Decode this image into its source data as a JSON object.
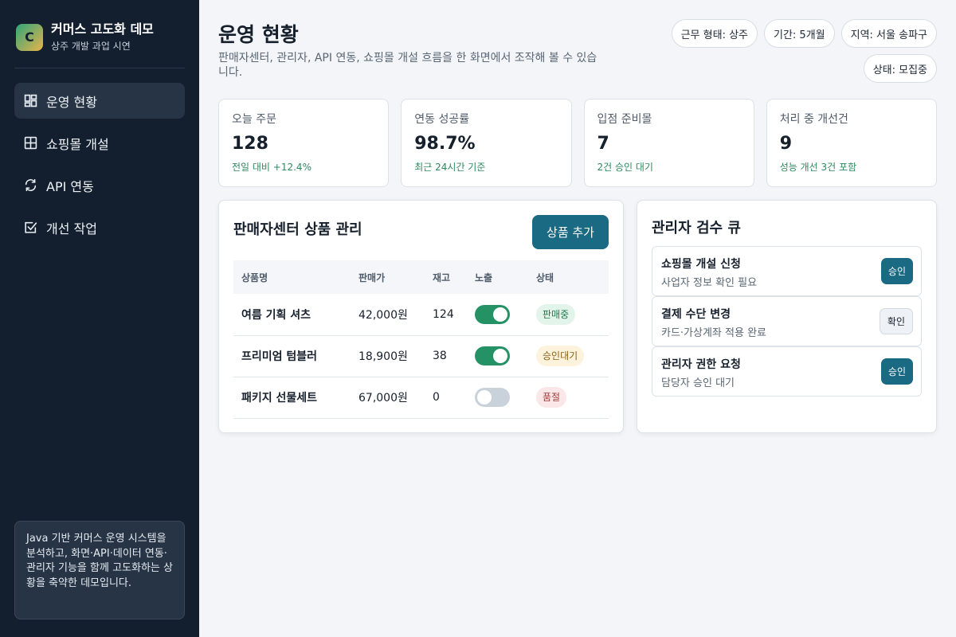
{
  "brand": {
    "logo_letter": "C",
    "title": "커머스 고도화 데모",
    "subtitle": "상주 개발 과업 시연"
  },
  "nav": [
    {
      "label": "운영 현황",
      "icon": "dashboard-icon",
      "active": true
    },
    {
      "label": "쇼핑몰 개설",
      "icon": "grid-icon",
      "active": false
    },
    {
      "label": "API 연동",
      "icon": "sync-icon",
      "active": false
    },
    {
      "label": "개선 작업",
      "icon": "checkbox-icon",
      "active": false
    }
  ],
  "sidebar_note": "Java 기반 커머스 운영 시스템을 분석하고, 화면·API·데이터 연동·관리자 기능을 함께 고도화하는 상황을 축약한 데모입니다.",
  "page": {
    "title": "운영 현황",
    "description": "판매자센터, 관리자, API 연동, 쇼핑몰 개설 흐름을 한 화면에서 조작해 볼 수 있습니다."
  },
  "chips": [
    "근무 형태: 상주",
    "기간: 5개월",
    "지역: 서울 송파구",
    "상태: 모집중"
  ],
  "stats": [
    {
      "label": "오늘 주문",
      "value": "128",
      "note": "전일 대비 +12.4%"
    },
    {
      "label": "연동 성공률",
      "value": "98.7%",
      "note": "최근 24시간 기준"
    },
    {
      "label": "입점 준비몰",
      "value": "7",
      "note": "2건 승인 대기"
    },
    {
      "label": "처리 중 개선건",
      "value": "9",
      "note": "성능 개선 3건 포함"
    }
  ],
  "products": {
    "title": "판매자센터 상품 관리",
    "add_label": "상품 추가",
    "columns": [
      "상품명",
      "판매가",
      "재고",
      "노출",
      "상태"
    ],
    "rows": [
      {
        "name": "여름 기획 셔츠",
        "price": "42,000원",
        "stock": "124",
        "visible": true,
        "status": "판매중",
        "status_bg": "#e3f5ea",
        "status_fg": "#1f7a4d"
      },
      {
        "name": "프리미엄 텀블러",
        "price": "18,900원",
        "stock": "38",
        "visible": true,
        "status": "승인대기",
        "status_bg": "#fdf3dc",
        "status_fg": "#8a6116"
      },
      {
        "name": "패키지 선물세트",
        "price": "67,000원",
        "stock": "0",
        "visible": false,
        "status": "품절",
        "status_bg": "#fbe7e7",
        "status_fg": "#a33a3a"
      }
    ]
  },
  "queue": {
    "title": "관리자 검수 큐",
    "items": [
      {
        "title": "쇼핑몰 개설 신청",
        "sub": "사업자 정보 확인 필요",
        "action": "승인",
        "primary": true
      },
      {
        "title": "결제 수단 변경",
        "sub": "카드·가상계좌 적용 완료",
        "action": "확인",
        "primary": false
      },
      {
        "title": "관리자 권한 요청",
        "sub": "담당자 승인 대기",
        "action": "승인",
        "primary": true
      }
    ]
  },
  "colors": {
    "sidebar_bg": "#131f2e",
    "accent": "#1b6a84",
    "toggle_on": "#249264",
    "positive": "#2f8a5f"
  }
}
